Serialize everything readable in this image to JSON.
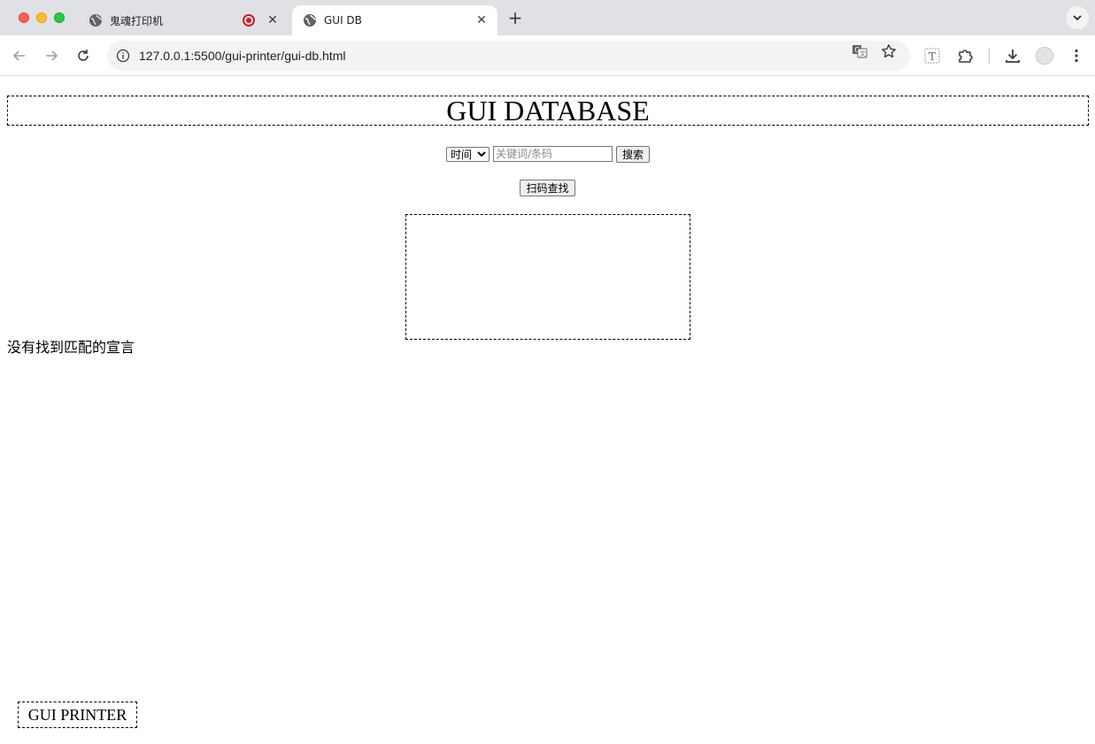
{
  "browser": {
    "tabs": [
      {
        "title": "鬼魂打印机",
        "active": false,
        "recording": true
      },
      {
        "title": "GUI DB",
        "active": true
      }
    ],
    "url": "127.0.0.1:5500/gui-printer/gui-db.html",
    "icons": {
      "back": "arrow-left-icon",
      "forward": "arrow-right-icon",
      "reload": "reload-icon",
      "site_info": "info-icon",
      "translate": "translate-icon",
      "bookmark": "star-icon",
      "reader": "text-icon",
      "extensions": "puzzle-icon",
      "downloads": "download-icon",
      "menu": "kebab-menu-icon"
    }
  },
  "page": {
    "title": "GUI DATABASE",
    "search": {
      "filter_selected": "时间",
      "placeholder": "关键词/条码",
      "value": "",
      "search_label": "搜索"
    },
    "scan_label": "扫码查找",
    "no_result_text": "没有找到匹配的宣言",
    "footer_label": "GUI PRINTER"
  }
}
